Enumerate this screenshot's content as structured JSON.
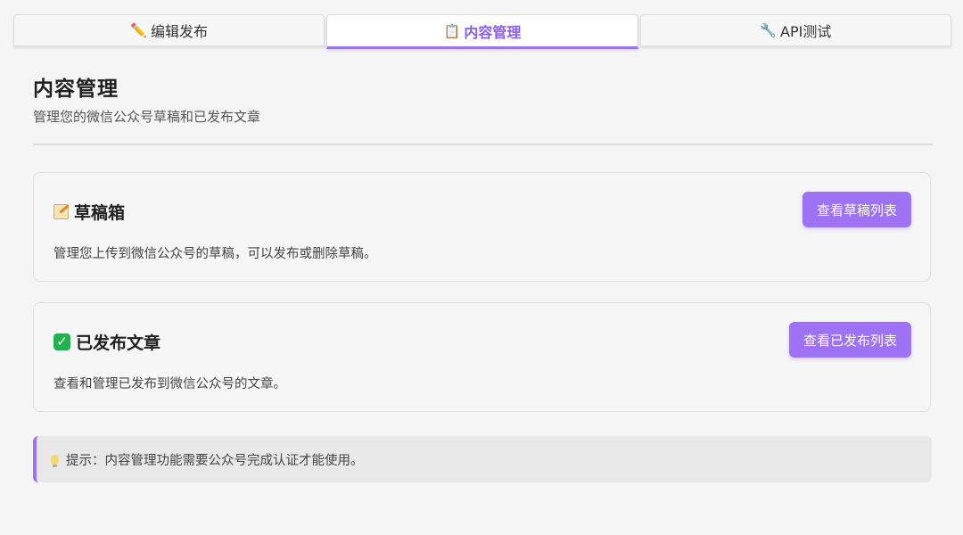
{
  "tabs": [
    {
      "icon": "✏️",
      "icon_name": "pencil-icon",
      "label": "编辑发布",
      "active": false
    },
    {
      "icon": "📋",
      "icon_name": "clipboard-icon",
      "label": "内容管理",
      "active": true
    },
    {
      "icon": "🔧",
      "icon_name": "wrench-icon",
      "label": "API测试",
      "active": false
    }
  ],
  "header": {
    "title": "内容管理",
    "subtitle": "管理您的微信公众号草稿和已发布文章"
  },
  "cards": {
    "drafts": {
      "icon_name": "memo-icon",
      "title": "草稿箱",
      "description": "管理您上传到微信公众号的草稿，可以发布或删除草稿。",
      "button_label": "查看草稿列表"
    },
    "published": {
      "icon_name": "check-mark-icon",
      "title": "已发布文章",
      "description": "查看和管理已发布到微信公众号的文章。",
      "button_label": "查看已发布列表"
    }
  },
  "tip": {
    "icon_name": "lightbulb-icon",
    "text": "提示：内容管理功能需要公众号完成认证才能使用。"
  },
  "colors": {
    "accent": "#9d72f5",
    "active_tab_text": "#8b5cf6",
    "background": "#f5f5f5"
  }
}
